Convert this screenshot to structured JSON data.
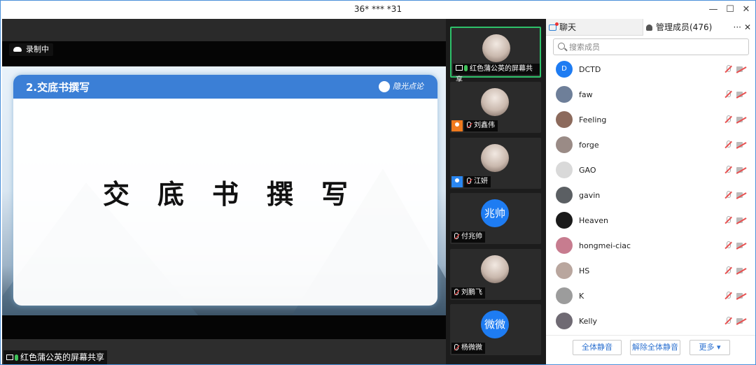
{
  "window": {
    "title": "36* *** *31",
    "minimize": "—",
    "maximize": "☐",
    "close": "✕"
  },
  "main": {
    "recording_label": "录制中",
    "share_label": "红色蒲公英的屏幕共享",
    "slide": {
      "header_title": "2.交底书撰写",
      "logo_text": "隐光点论",
      "big_title": "交底书撰写"
    }
  },
  "tiles": [
    {
      "name": "红色蒲公英的屏幕共享",
      "avatar_text": "",
      "active": true
    },
    {
      "name": "刘鑫伟",
      "avatar_text": "",
      "host": "orange"
    },
    {
      "name": "江妍",
      "avatar_text": "",
      "host": "blue"
    },
    {
      "name": "付兆帅",
      "avatar_text": "兆帅"
    },
    {
      "name": "刘鹏飞",
      "avatar_text": ""
    },
    {
      "name": "杨微微",
      "avatar_text": "微微"
    }
  ],
  "panel": {
    "tab_chat": "聊天",
    "tab_members": "管理成员(476)",
    "tab_more": "···",
    "tab_close": "✕",
    "search_placeholder": "搜索成员",
    "members": [
      {
        "name": "DCTD",
        "avatar_text": "D",
        "color": "#1e7cf2"
      },
      {
        "name": "faw",
        "avatar_text": "",
        "color": "#6e7f99"
      },
      {
        "name": "Feeling",
        "avatar_text": "",
        "color": "#8c6a5c"
      },
      {
        "name": "forge",
        "avatar_text": "",
        "color": "#9a8b86"
      },
      {
        "name": "GAO",
        "avatar_text": "",
        "color": "#d9d9d9"
      },
      {
        "name": "gavin",
        "avatar_text": "",
        "color": "#5b5f63"
      },
      {
        "name": "Heaven",
        "avatar_text": "",
        "color": "#1a1a1a"
      },
      {
        "name": "hongmei-ciac",
        "avatar_text": "",
        "color": "#c77c8f"
      },
      {
        "name": "HS",
        "avatar_text": "",
        "color": "#b9a69e"
      },
      {
        "name": "K",
        "avatar_text": "",
        "color": "#9c9c9c"
      },
      {
        "name": "Kelly",
        "avatar_text": "",
        "color": "#6f6a73"
      }
    ],
    "footer": {
      "mute_all": "全体静音",
      "unmute_all": "解除全体静音",
      "more": "更多 ▾"
    }
  }
}
